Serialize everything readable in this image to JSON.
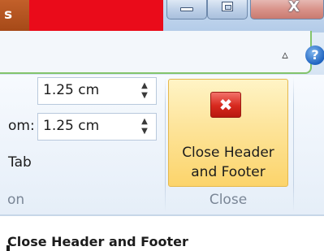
{
  "titlebar": {
    "contextual_tab_edge_text": "s",
    "contextual_color": "#ea0b1a",
    "minimize_icon": "minimize-icon",
    "maximize_icon": "maximize-icon",
    "close_icon": "close-window-icon",
    "close_glyph": "X"
  },
  "tabstrip": {
    "collapse_glyph": "▵",
    "help_glyph": "?"
  },
  "position_group": {
    "top_margin_value": "1.25 cm",
    "bottom_label": "om:",
    "bottom_margin_value": "1.25 cm",
    "tab_label": "Tab",
    "group_label": "on",
    "spin_up": "▲",
    "spin_down": "▼"
  },
  "close_group": {
    "button_icon": "close-red-x-icon",
    "button_glyph": "✖",
    "button_line1": "Close Header",
    "button_line2": "and Footer",
    "group_label": "Close",
    "highlight_color": "#fcd46b"
  },
  "tooltip": {
    "title": "Close Header and Footer"
  }
}
